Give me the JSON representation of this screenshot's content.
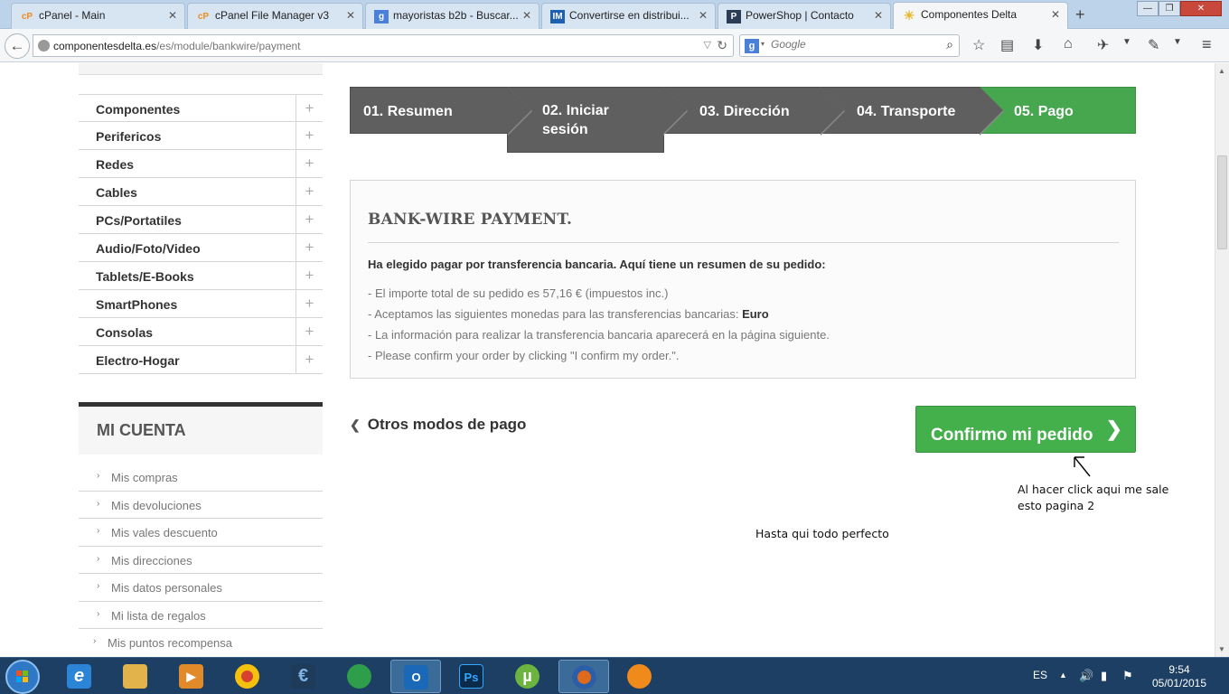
{
  "browser": {
    "tabs": [
      {
        "title": "cPanel - Main",
        "icon": "cpanel-icon",
        "color": "#f08c20"
      },
      {
        "title": "cPanel File Manager v3",
        "icon": "cpanel-icon",
        "color": "#f08c20"
      },
      {
        "title": "mayoristas b2b - Buscar...",
        "icon": "google-icon",
        "color": "#4a80d8"
      },
      {
        "title": "Convertirse en distribui...",
        "icon": "im-icon",
        "color": "#1d5fb0"
      },
      {
        "title": "PowerShop | Contacto",
        "icon": "powershop-icon",
        "color": "#2b3d55"
      },
      {
        "title": "Componentes Delta",
        "icon": "loading-icon",
        "color": "#e8b830"
      }
    ],
    "url_domain": "componentesdelta.es",
    "url_path": "/es/module/bankwire/payment",
    "search_placeholder": "Google"
  },
  "sidebar": {
    "categories": [
      "Componentes",
      "Perifericos",
      "Redes",
      "Cables",
      "PCs/Portatiles",
      "Audio/Foto/Video",
      "Tablets/E-Books",
      "SmartPhones",
      "Consolas",
      "Electro-Hogar"
    ],
    "account_title": "MI CUENTA",
    "account_links": [
      "Mis compras",
      "Mis devoluciones",
      "Mis vales descuento",
      "Mis direcciones",
      "Mis datos personales",
      "Mi lista de regalos",
      "Mis puntos recompensa"
    ]
  },
  "steps": [
    "01. Resumen",
    "02. Iniciar sesión",
    "03. Dirección",
    "04. Transporte",
    "05. Pago"
  ],
  "payment": {
    "title": "BANK-WIRE PAYMENT.",
    "lead": "Ha elegido pagar por transferencia bancaria. Aquí tiene un resumen de su pedido:",
    "line1": "- El importe total de su pedido es 57,16 € (impuestos inc.)",
    "line2_prefix": "- Aceptamos las siguientes monedas para las transferencias bancarias: ",
    "line2_currency": "Euro",
    "line3": "- La información para realizar la transferencia bancaria aparecerá en la página siguiente.",
    "line4": "- Please confirm your order by clicking \"I confirm my order.\"."
  },
  "actions": {
    "other_methods": "Otros modos de pago",
    "confirm": "Confirmo mi pedido"
  },
  "annotations": {
    "note1_line1": "Al hacer click aqui me sale",
    "note1_line2": "esto pagina 2",
    "note2": "Hasta qui todo perfecto"
  },
  "taskbar": {
    "apps": [
      {
        "name": "internet-explorer-icon",
        "label": "e",
        "color": "#2b84d6"
      },
      {
        "name": "file-explorer-icon",
        "label": "",
        "color": "#e2b34a"
      },
      {
        "name": "media-player-icon",
        "label": "▶",
        "color": "#e08a2a"
      },
      {
        "name": "chrome-icon",
        "label": "",
        "color": "#d8412f"
      },
      {
        "name": "eclipse-icon",
        "label": "€",
        "color": "#1f3b5a"
      },
      {
        "name": "app-leaf-icon",
        "label": "",
        "color": "#2e9e4b"
      },
      {
        "name": "outlook-icon",
        "label": "O",
        "color": "#1a68b8"
      },
      {
        "name": "photoshop-icon",
        "label": "Ps",
        "color": "#0c2a4a"
      },
      {
        "name": "utorrent-icon",
        "label": "µ",
        "color": "#6cb33f"
      },
      {
        "name": "firefox-icon",
        "label": "",
        "color": "#e06a1b"
      },
      {
        "name": "messenger-icon",
        "label": "",
        "color": "#f08a1a"
      }
    ],
    "lang": "ES",
    "time": "9:54",
    "date": "05/01/2015"
  }
}
